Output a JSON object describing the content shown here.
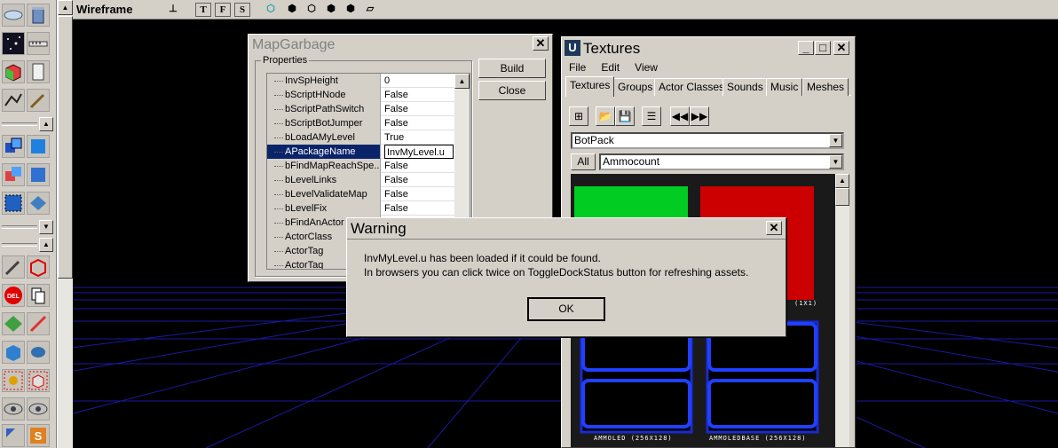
{
  "viewport": {
    "title": "Wireframe",
    "toolbar_buttons": [
      "T",
      "F",
      "S"
    ]
  },
  "mapgarbage": {
    "title": "MapGarbage",
    "properties_label": "Properties",
    "build_label": "Build",
    "close_label": "Close",
    "properties": [
      {
        "name": "InvSpHeight",
        "value": "0"
      },
      {
        "name": "bScriptHNode",
        "value": "False"
      },
      {
        "name": "bScriptPathSwitch",
        "value": "False"
      },
      {
        "name": "bScriptBotJumper",
        "value": "False"
      },
      {
        "name": "bLoadAMyLevel",
        "value": "True"
      },
      {
        "name": "APackageName",
        "value": "InvMyLevel.u"
      },
      {
        "name": "bFindMapReachSpe...",
        "value": "False"
      },
      {
        "name": "bLevelLinks",
        "value": "False"
      },
      {
        "name": "bLevelValidateMap",
        "value": "False"
      },
      {
        "name": "bLevelFix",
        "value": "False"
      },
      {
        "name": "bFindAnActor",
        "value": ""
      },
      {
        "name": "ActorClass",
        "value": ""
      },
      {
        "name": "ActorTag",
        "value": ""
      },
      {
        "name": "ActorTag",
        "value": ""
      }
    ],
    "selected_index": 5
  },
  "textures": {
    "title": "Textures",
    "menu": [
      "File",
      "Edit",
      "View"
    ],
    "tabs": [
      "Textures",
      "Groups",
      "Actor Classes",
      "Sounds",
      "Music",
      "Meshes"
    ],
    "package": "BotPack",
    "all_label": "All",
    "group": "Ammocount",
    "tiles": [
      {
        "label": "",
        "color": "#00cc22"
      },
      {
        "label": "(1X1)",
        "color": "#cc0000"
      },
      {
        "label": "AMMOLED (256X128)",
        "color": "#0a0a6a"
      },
      {
        "label": "AMMOLEDBASE (256X128)",
        "color": "#0a0a6a"
      }
    ]
  },
  "warning": {
    "title": "Warning",
    "message_line1": "InvMyLevel.u has been loaded if it could be found.",
    "message_line2": "In browsers you can click twice on ToggleDockStatus button for refreshing assets.",
    "ok_label": "OK"
  }
}
